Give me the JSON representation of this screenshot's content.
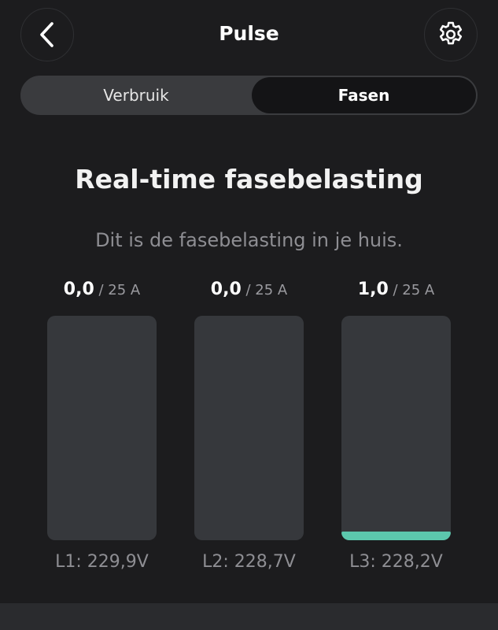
{
  "header": {
    "title": "Pulse",
    "back_icon": "chevron-left-icon",
    "settings_icon": "gear-icon"
  },
  "tabs": [
    {
      "label": "Verbruik",
      "selected": false
    },
    {
      "label": "Fasen",
      "selected": true
    }
  ],
  "main": {
    "headline": "Real-time fasebelasting",
    "subtitle": "Dit is de fasebelasting in je huis."
  },
  "phases": [
    {
      "value": "0,0",
      "max_label": " / 25 A",
      "load_fraction": 0.0,
      "voltage": "L1: 229,9V"
    },
    {
      "value": "0,0",
      "max_label": " / 25 A",
      "load_fraction": 0.0,
      "voltage": "L2: 228,7V"
    },
    {
      "value": "1,0",
      "max_label": " / 25 A",
      "load_fraction": 0.04,
      "voltage": "L3: 228,2V"
    }
  ],
  "colors": {
    "background": "#1c1c1e",
    "bar_track": "#36383c",
    "bar_fill": "#5cc7ad",
    "muted_text": "#8e8e93"
  }
}
